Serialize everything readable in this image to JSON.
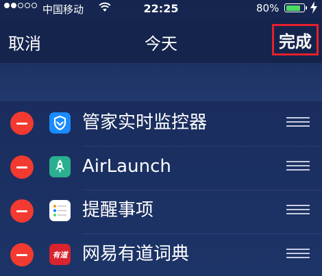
{
  "status_bar": {
    "signal_full_dots": 2,
    "signal_total_dots": 5,
    "carrier": "中国移动",
    "time": "22:25",
    "battery_percent_label": "80%",
    "battery_level": 0.8,
    "charging": true
  },
  "nav": {
    "cancel_label": "取消",
    "title": "今天",
    "done_label": "完成"
  },
  "widgets": [
    {
      "name": "管家实时监控器",
      "icon": "shield-check-icon",
      "icon_color": "#1a8cff"
    },
    {
      "name": "AirLaunch",
      "icon": "rocket-icon",
      "icon_color": "#2ab08f"
    },
    {
      "name": "提醒事项",
      "icon": "reminders-list-icon",
      "icon_color": "#ffffff"
    },
    {
      "name": "网易有道词典",
      "icon": "youdao-dict-icon",
      "icon_color": "#d9232e",
      "icon_text": "有道"
    }
  ],
  "colors": {
    "remove_button": "#f23a30",
    "highlight_border": "#e8202a",
    "battery_fill": "#4cd964"
  }
}
